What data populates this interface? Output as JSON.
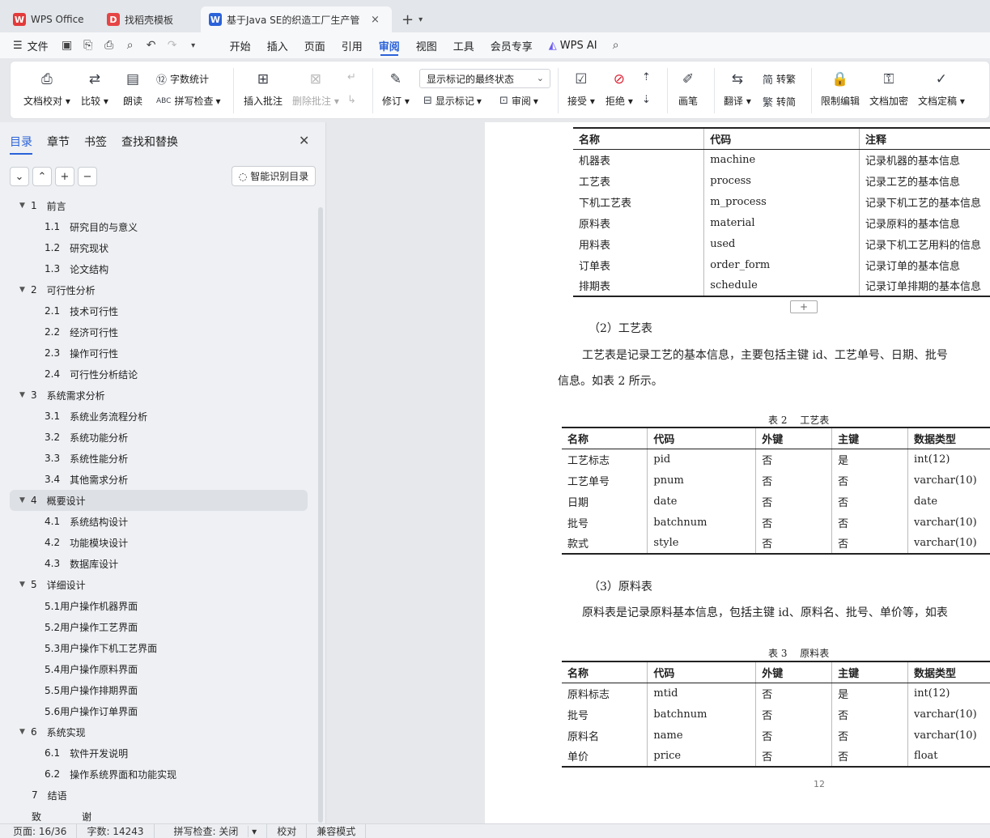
{
  "tabs": [
    {
      "label": "WPS Office",
      "logo": "W",
      "color": "#e33a3a"
    },
    {
      "label": "找稻壳模板",
      "logo": "D",
      "color": "#e64545"
    },
    {
      "label": "基于Java SE的织造工厂生产管",
      "logo": "W",
      "color": "#2a62d9"
    }
  ],
  "menu": {
    "file": "文件",
    "items": [
      "开始",
      "插入",
      "页面",
      "引用",
      "审阅",
      "视图",
      "工具",
      "会员专享"
    ],
    "active": "审阅",
    "ai": "WPS AI"
  },
  "ribbon": {
    "doc_check": "文档校对",
    "compare": "比较",
    "read": "朗读",
    "word_count": "字数统计",
    "spell_check": "拼写检查",
    "insert_comment": "插入批注",
    "delete_comment": "删除批注",
    "revise": "修订",
    "markup_state": "显示标记的最终状态",
    "show_markup": "显示标记",
    "review": "审阅",
    "accept": "接受",
    "reject": "拒绝",
    "pen": "画笔",
    "translate": "翻译",
    "to_trad": "转繁",
    "to_simp": "转简",
    "restrict": "限制编辑",
    "encrypt": "文档加密",
    "finalize": "文档定稿"
  },
  "sidebar": {
    "tabs": [
      "目录",
      "章节",
      "书签",
      "查找和替换"
    ],
    "ai_toc": "智能识别目录",
    "toc": [
      {
        "level": 1,
        "num": "1",
        "text": "前言",
        "tw": true
      },
      {
        "level": 2,
        "num": "1.1",
        "text": "研究目的与意义"
      },
      {
        "level": 2,
        "num": "1.2",
        "text": "研究现状"
      },
      {
        "level": 2,
        "num": "1.3",
        "text": "论文结构"
      },
      {
        "level": 1,
        "num": "2",
        "text": "可行性分析",
        "tw": true
      },
      {
        "level": 2,
        "num": "2.1",
        "text": "技术可行性"
      },
      {
        "level": 2,
        "num": "2.2",
        "text": "经济可行性"
      },
      {
        "level": 2,
        "num": "2.3",
        "text": "操作可行性"
      },
      {
        "level": 2,
        "num": "2.4",
        "text": "可行性分析结论"
      },
      {
        "level": 1,
        "num": "3",
        "text": "系统需求分析",
        "tw": true
      },
      {
        "level": 2,
        "num": "3.1",
        "text": "系统业务流程分析"
      },
      {
        "level": 2,
        "num": "3.2",
        "text": "系统功能分析"
      },
      {
        "level": 2,
        "num": "3.3",
        "text": "系统性能分析"
      },
      {
        "level": 2,
        "num": "3.4",
        "text": "其他需求分析"
      },
      {
        "level": 1,
        "num": "4",
        "text": "概要设计",
        "tw": true,
        "selected": true
      },
      {
        "level": 2,
        "num": "4.1",
        "text": "系统结构设计"
      },
      {
        "level": 2,
        "num": "4.2",
        "text": "功能模块设计"
      },
      {
        "level": 2,
        "num": "4.3",
        "text": "数据库设计"
      },
      {
        "level": 1,
        "num": "5",
        "text": "详细设计",
        "tw": true
      },
      {
        "level": 2,
        "num": "",
        "text": "5.1用户操作机器界面"
      },
      {
        "level": 2,
        "num": "",
        "text": "5.2用户操作工艺界面"
      },
      {
        "level": 2,
        "num": "",
        "text": "5.3用户操作下机工艺界面"
      },
      {
        "level": 2,
        "num": "",
        "text": "5.4用户操作原料界面"
      },
      {
        "level": 2,
        "num": "",
        "text": "5.5用户操作排期界面"
      },
      {
        "level": 2,
        "num": "",
        "text": "5.6用户操作订单界面"
      },
      {
        "level": 1,
        "num": "6",
        "text": "系统实现",
        "tw": true
      },
      {
        "level": 2,
        "num": "6.1",
        "text": "软件开发说明"
      },
      {
        "level": 2,
        "num": "6.2",
        "text": "操作系统界面和功能实现"
      },
      {
        "level": 1,
        "num": "7",
        "text": "结语",
        "tw": false
      },
      {
        "level": 1,
        "num": "致",
        "text": "谢",
        "tw": false
      }
    ]
  },
  "document": {
    "table1": {
      "headers": [
        "名称",
        "代码",
        "注释"
      ],
      "rows": [
        [
          "机器表",
          "machine",
          "记录机器的基本信息"
        ],
        [
          "工艺表",
          "process",
          "记录工艺的基本信息"
        ],
        [
          "下机工艺表",
          "m_process",
          "记录下机工艺的基本信息"
        ],
        [
          "原料表",
          "material",
          "记录原料的基本信息"
        ],
        [
          "用料表",
          "used",
          "记录下机工艺用料的信息"
        ],
        [
          "订单表",
          "order_form",
          "记录订单的基本信息"
        ],
        [
          "排期表",
          "schedule",
          "记录订单排期的基本信息"
        ]
      ]
    },
    "sec2_title": "（2）工艺表",
    "sec2_p1": "工艺表是记录工艺的基本信息，主要包括主键 id、工艺单号、日期、批号",
    "sec2_p2": "信息。如表 2 所示。",
    "table2_caption": "表 2　 工艺表",
    "table2": {
      "headers": [
        "名称",
        "代码",
        "外键",
        "主键",
        "数据类型"
      ],
      "rows": [
        [
          "工艺标志",
          "pid",
          "否",
          "是",
          "int(12)"
        ],
        [
          "工艺单号",
          "pnum",
          "否",
          "否",
          "varchar(10)"
        ],
        [
          "日期",
          "date",
          "否",
          "否",
          "date"
        ],
        [
          "批号",
          "batchnum",
          "否",
          "否",
          "varchar(10)"
        ],
        [
          "款式",
          "style",
          "否",
          "否",
          "varchar(10)"
        ]
      ]
    },
    "sec3_title": "（3）原料表",
    "sec3_p1": "原料表是记录原料基本信息，包括主键 id、原料名、批号、单价等，如表",
    "table3_caption": "表 3　 原料表",
    "table3": {
      "headers": [
        "名称",
        "代码",
        "外键",
        "主键",
        "数据类型"
      ],
      "rows": [
        [
          "原料标志",
          "mtid",
          "否",
          "是",
          "int(12)"
        ],
        [
          "批号",
          "batchnum",
          "否",
          "否",
          "varchar(10)"
        ],
        [
          "原料名",
          "name",
          "否",
          "否",
          "varchar(10)"
        ],
        [
          "单价",
          "price",
          "否",
          "否",
          "float"
        ]
      ]
    },
    "page_number": "12"
  },
  "status": {
    "page": "页面: 16/36",
    "words": "字数: 14243",
    "spell": "拼写检查: 关闭",
    "proof": "校对",
    "compat": "兼容模式"
  }
}
